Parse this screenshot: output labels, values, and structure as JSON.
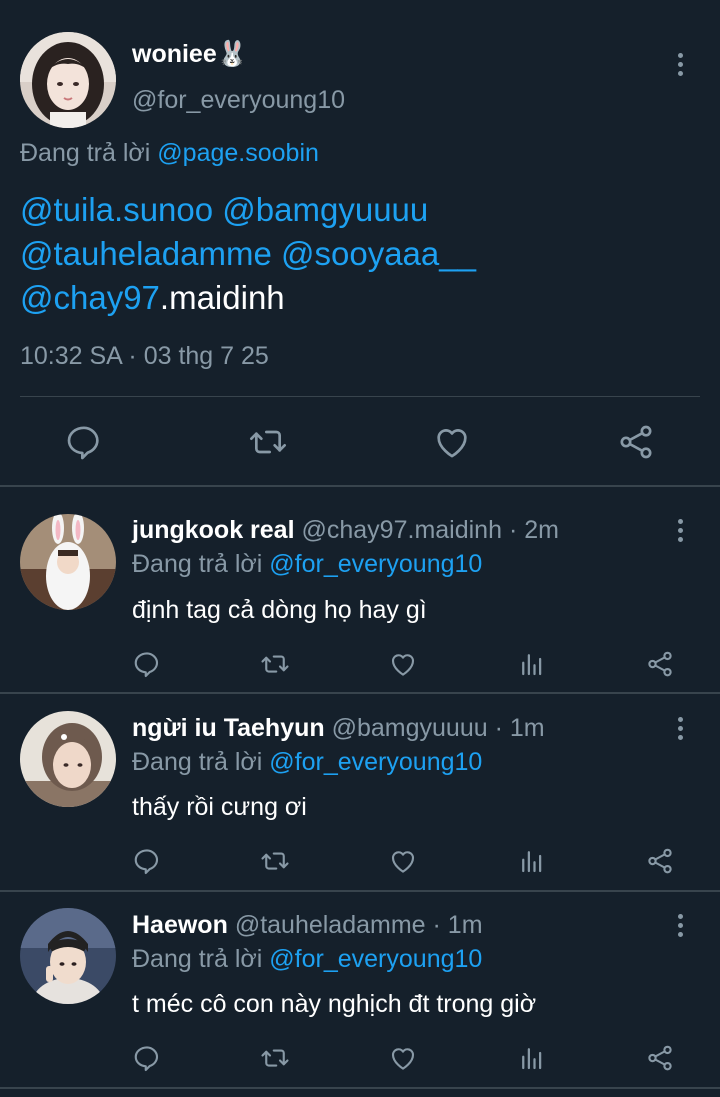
{
  "main_tweet": {
    "display_name": "woniee",
    "name_emoji": "🐰",
    "handle": "@for_everyoung10",
    "replying_prefix": "Đang trả lời",
    "replying_to": "@page.soobin",
    "mentions": [
      "@tuila.sunoo",
      "@bamgyuuuu",
      "@tauheladamme",
      "@sooyaaa__",
      "@chay97"
    ],
    "trailing_text": ".maidinh",
    "timestamp": "10:32 SA · 03 thg 7 25"
  },
  "replies": [
    {
      "display_name": "jungkook real",
      "handle": "@chay97.maidinh",
      "age": "· 2m",
      "replying_prefix": "Đang trả lời",
      "replying_to": "@for_everyoung10",
      "text": "định tag cả dòng họ hay gì"
    },
    {
      "display_name": "ngừi iu Taehyun",
      "handle": "@bamgyuuuu",
      "age": "· 1m",
      "replying_prefix": "Đang trả lời",
      "replying_to": "@for_everyoung10",
      "text": "thấy rồi cưng ơi"
    },
    {
      "display_name": "Haewon",
      "handle": "@tauheladamme",
      "age": "· 1m",
      "replying_prefix": "Đang trả lời",
      "replying_to": "@for_everyoung10",
      "text": "t méc cô con này nghịch đt trong giờ"
    }
  ],
  "icons": {
    "reply": "reply-icon",
    "retweet": "retweet-icon",
    "like": "heart-icon",
    "views": "analytics-icon",
    "share": "share-icon",
    "more": "more-vertical-icon"
  },
  "colors": {
    "background": "#15202b",
    "link": "#1da1f2",
    "secondary_text": "#8899a6",
    "divider": "#38444d"
  }
}
